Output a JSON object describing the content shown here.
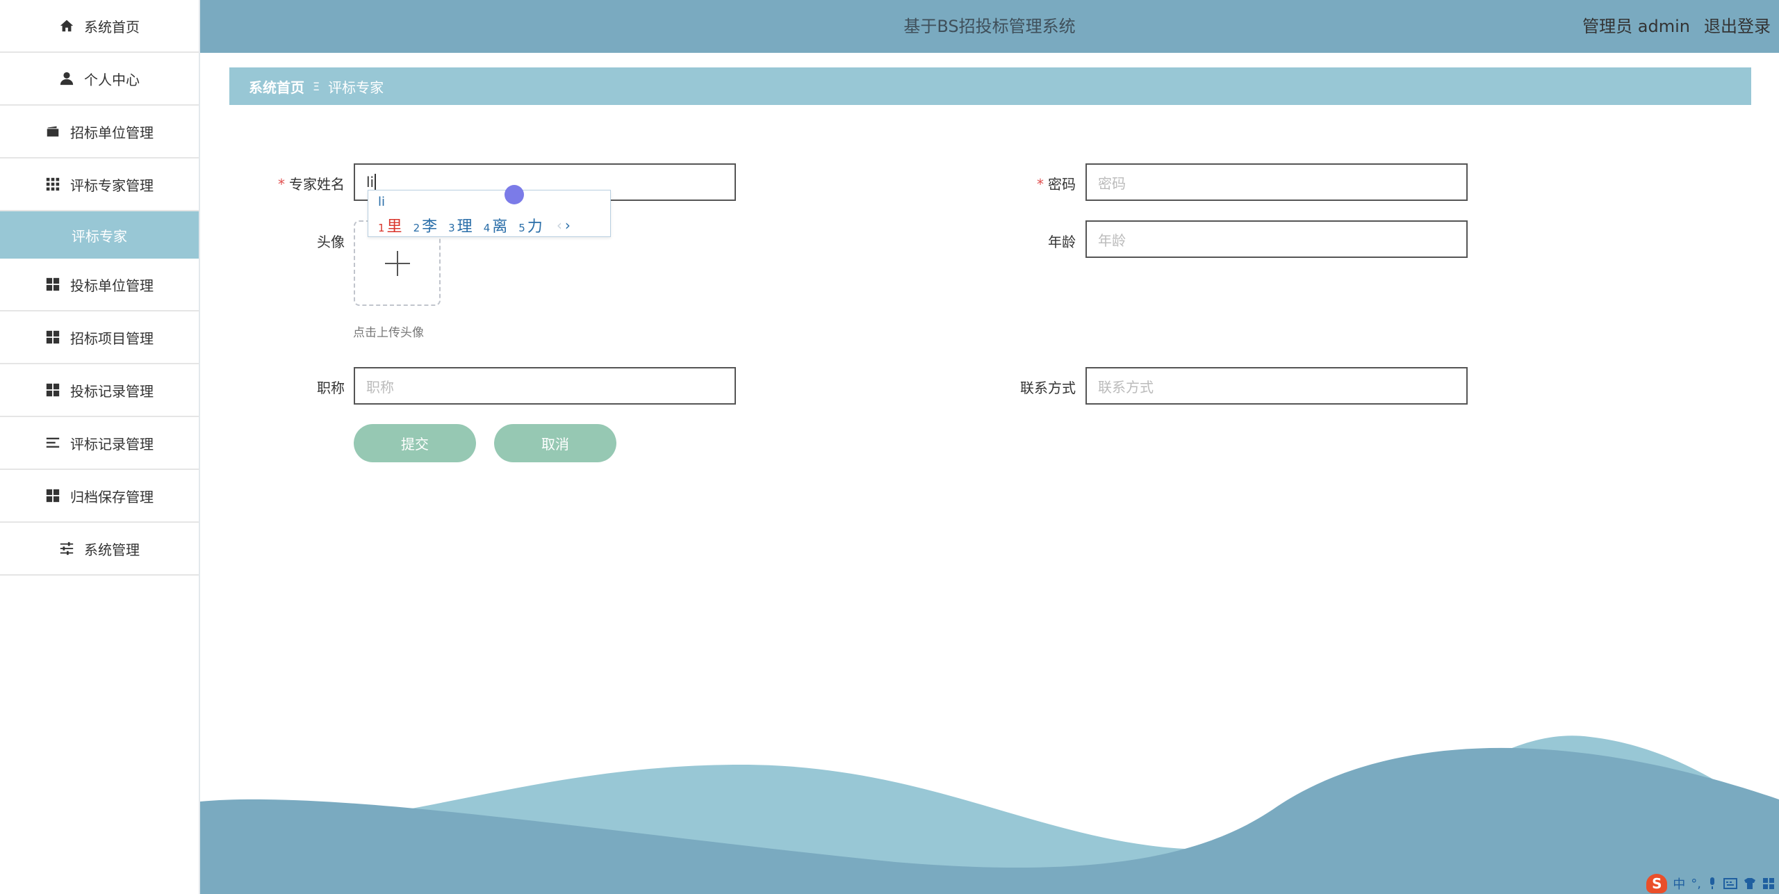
{
  "header": {
    "title": "基于BS招投标管理系统",
    "user": "管理员 admin",
    "logout": "退出登录"
  },
  "sidebar": {
    "items": [
      {
        "label": "系统首页",
        "icon": "home-icon"
      },
      {
        "label": "个人中心",
        "icon": "user-icon"
      },
      {
        "label": "招标单位管理",
        "icon": "wallet-icon"
      },
      {
        "label": "评标专家管理",
        "icon": "grid-icon"
      },
      {
        "label": "投标单位管理",
        "icon": "apps-icon"
      },
      {
        "label": "招标项目管理",
        "icon": "apps-icon"
      },
      {
        "label": "投标记录管理",
        "icon": "apps-icon"
      },
      {
        "label": "评标记录管理",
        "icon": "list-icon"
      },
      {
        "label": "归档保存管理",
        "icon": "apps-icon"
      },
      {
        "label": "系统管理",
        "icon": "sliders-icon"
      }
    ],
    "active_sub": "评标专家"
  },
  "breadcrumb": {
    "home": "系统首页",
    "separator": "Ξ",
    "current": "评标专家"
  },
  "form": {
    "name_label": "专家姓名",
    "name_value": "li",
    "password_label": "密码",
    "password_placeholder": "密码",
    "avatar_label": "头像",
    "upload_tip": "点击上传头像",
    "age_label": "年龄",
    "age_placeholder": "年龄",
    "title_label": "职称",
    "title_placeholder": "职称",
    "contact_label": "联系方式",
    "contact_placeholder": "联系方式",
    "required_mark": "*",
    "submit": "提交",
    "cancel": "取消"
  },
  "ime": {
    "pinyin": "li",
    "candidates": [
      {
        "num": "1",
        "char": "里"
      },
      {
        "num": "2",
        "char": "李"
      },
      {
        "num": "3",
        "char": "理"
      },
      {
        "num": "4",
        "char": "离"
      },
      {
        "num": "5",
        "char": "力"
      }
    ],
    "prev": "‹",
    "next": "›"
  },
  "tray": {
    "logo": "S",
    "lang": "中",
    "punct": "°,"
  },
  "colors": {
    "header": "#7aaac0",
    "accent": "#98c7d5",
    "button": "#96c8b3",
    "wave_dark": "#7aaac0",
    "wave_light": "#98c7d5"
  }
}
